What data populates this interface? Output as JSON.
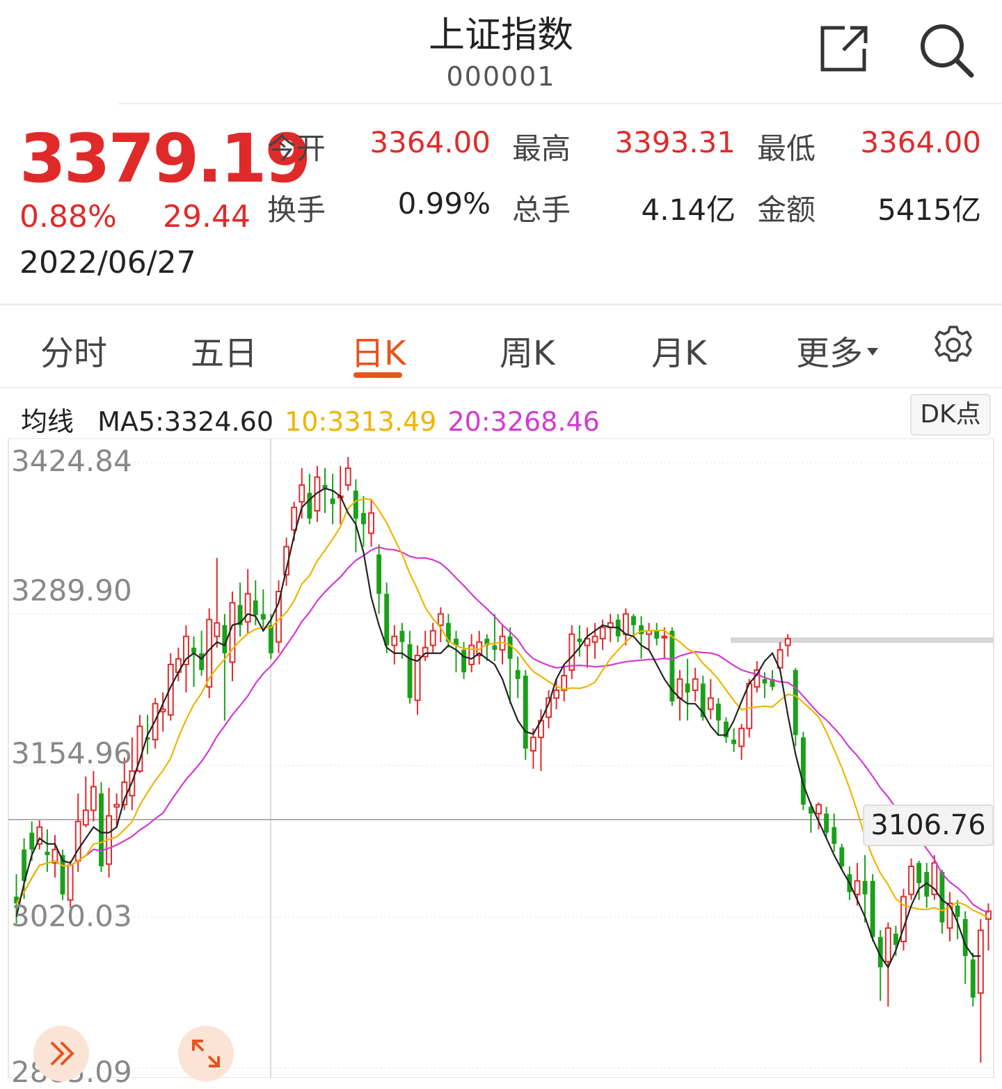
{
  "header": {
    "title": "上证指数",
    "code": "000001",
    "share_icon": "share-icon",
    "search_icon": "search-icon"
  },
  "quote": {
    "price": "3379.19",
    "change_pct": "0.88%",
    "change_value": "29.44",
    "date": "2022/06/27",
    "fields": {
      "open_label": "今开",
      "open_value": "3364.00",
      "high_label": "最高",
      "high_value": "3393.31",
      "low_label": "最低",
      "low_value": "3364.00",
      "turnover_label": "换手",
      "turnover_value": "0.99%",
      "volume_label": "总手",
      "volume_value": "4.14亿",
      "amount_label": "金额",
      "amount_value": "5415亿"
    }
  },
  "tabs": [
    {
      "label": "分时"
    },
    {
      "label": "五日"
    },
    {
      "label": "日K",
      "active": true
    },
    {
      "label": "周K"
    },
    {
      "label": "月K"
    },
    {
      "label": "更多"
    }
  ],
  "settings_icon": "gear-icon",
  "ma": {
    "label": "均线",
    "ma5": "MA5:3324.60",
    "ma10": "10:3313.49",
    "ma20": "20:3268.46",
    "dk_button": "DK点"
  },
  "colors": {
    "up": "#e02a2a",
    "down": "#1aa01a",
    "ma5": "#222222",
    "ma10": "#f0b400",
    "ma20": "#d23ad2",
    "accent": "#e8541c"
  },
  "chart_data": {
    "type": "candlestick",
    "y_axis_labels": [
      "3424.84",
      "3289.90",
      "3154.96",
      "3020.03",
      "2885.09"
    ],
    "crosshair_value": "3106.76",
    "ylim": [
      2885.09,
      3424.84
    ],
    "candles": [
      [
        3038,
        3032,
        3058,
        3014
      ],
      [
        3080,
        3052,
        3090,
        3036
      ],
      [
        3095,
        3080,
        3105,
        3070
      ],
      [
        3085,
        3100,
        3106,
        3080
      ],
      [
        3078,
        3075,
        3098,
        3060
      ],
      [
        3068,
        3080,
        3093,
        3055
      ],
      [
        3075,
        3040,
        3080,
        3035
      ],
      [
        3035,
        3066,
        3070,
        3028
      ],
      [
        3070,
        3105,
        3130,
        3060
      ],
      [
        3102,
        3115,
        3145,
        3100
      ],
      [
        3115,
        3136,
        3150,
        3105
      ],
      [
        3130,
        3065,
        3140,
        3060
      ],
      [
        3067,
        3110,
        3135,
        3055
      ],
      [
        3118,
        3120,
        3130,
        3100
      ],
      [
        3120,
        3140,
        3162,
        3115
      ],
      [
        3128,
        3150,
        3180,
        3115
      ],
      [
        3150,
        3190,
        3200,
        3148
      ],
      [
        3180,
        3178,
        3200,
        3165
      ],
      [
        3178,
        3210,
        3215,
        3170
      ],
      [
        3203,
        3205,
        3220,
        3185
      ],
      [
        3200,
        3245,
        3255,
        3195
      ],
      [
        3238,
        3250,
        3260,
        3230
      ],
      [
        3245,
        3270,
        3280,
        3220
      ],
      [
        3260,
        3255,
        3270,
        3225
      ],
      [
        3255,
        3240,
        3275,
        3235
      ],
      [
        3225,
        3285,
        3295,
        3215
      ],
      [
        3270,
        3282,
        3340,
        3260
      ],
      [
        3280,
        3255,
        3290,
        3195
      ],
      [
        3247,
        3300,
        3310,
        3230
      ],
      [
        3298,
        3280,
        3318,
        3270
      ],
      [
        3283,
        3308,
        3330,
        3272
      ],
      [
        3302,
        3289,
        3320,
        3280
      ],
      [
        3290,
        3285,
        3312,
        3275
      ],
      [
        3280,
        3255,
        3290,
        3250
      ],
      [
        3265,
        3310,
        3320,
        3255
      ],
      [
        3325,
        3350,
        3358,
        3315
      ],
      [
        3365,
        3385,
        3390,
        3355
      ],
      [
        3390,
        3405,
        3420,
        3375
      ],
      [
        3398,
        3375,
        3415,
        3370
      ],
      [
        3382,
        3412,
        3422,
        3372
      ],
      [
        3405,
        3402,
        3420,
        3380
      ],
      [
        3393,
        3388,
        3415,
        3370
      ],
      [
        3395,
        3395,
        3422,
        3370
      ],
      [
        3405,
        3420,
        3430,
        3400
      ],
      [
        3400,
        3375,
        3410,
        3345
      ],
      [
        3380,
        3370,
        3395,
        3350
      ],
      [
        3362,
        3380,
        3392,
        3350
      ],
      [
        3343,
        3308,
        3352,
        3290
      ],
      [
        3308,
        3262,
        3318,
        3255
      ],
      [
        3262,
        3270,
        3280,
        3245
      ],
      [
        3275,
        3265,
        3282,
        3250
      ],
      [
        3263,
        3215,
        3275,
        3210
      ],
      [
        3213,
        3253,
        3262,
        3200
      ],
      [
        3252,
        3260,
        3275,
        3248
      ],
      [
        3262,
        3275,
        3282,
        3255
      ],
      [
        3280,
        3290,
        3296,
        3265
      ],
      [
        3282,
        3265,
        3290,
        3260
      ],
      [
        3268,
        3262,
        3275,
        3238
      ],
      [
        3258,
        3238,
        3265,
        3232
      ],
      [
        3245,
        3262,
        3272,
        3238
      ],
      [
        3253,
        3265,
        3275,
        3245
      ],
      [
        3268,
        3262,
        3272,
        3248
      ],
      [
        3262,
        3258,
        3290,
        3248
      ],
      [
        3258,
        3270,
        3280,
        3245
      ],
      [
        3270,
        3250,
        3278,
        3210
      ],
      [
        3240,
        3232,
        3252,
        3215
      ],
      [
        3235,
        3170,
        3240,
        3160
      ],
      [
        3168,
        3180,
        3188,
        3152
      ],
      [
        3180,
        3195,
        3205,
        3150
      ],
      [
        3198,
        3215,
        3222,
        3188
      ],
      [
        3215,
        3222,
        3232,
        3205
      ],
      [
        3222,
        3235,
        3245,
        3212
      ],
      [
        3240,
        3272,
        3280,
        3232
      ],
      [
        3268,
        3265,
        3280,
        3252
      ],
      [
        3262,
        3268,
        3278,
        3242
      ],
      [
        3265,
        3270,
        3282,
        3250
      ],
      [
        3268,
        3278,
        3285,
        3258
      ],
      [
        3278,
        3282,
        3290,
        3265
      ],
      [
        3285,
        3270,
        3290,
        3265
      ],
      [
        3272,
        3290,
        3295,
        3262
      ],
      [
        3288,
        3280,
        3290,
        3270
      ],
      [
        3280,
        3272,
        3288,
        3250
      ],
      [
        3272,
        3275,
        3282,
        3258
      ],
      [
        3275,
        3268,
        3282,
        3262
      ],
      [
        3270,
        3270,
        3278,
        3250
      ],
      [
        3275,
        3212,
        3278,
        3208
      ],
      [
        3215,
        3232,
        3240,
        3195
      ],
      [
        3228,
        3220,
        3250,
        3195
      ],
      [
        3222,
        3232,
        3242,
        3212
      ],
      [
        3228,
        3198,
        3235,
        3195
      ],
      [
        3205,
        3215,
        3232,
        3196
      ],
      [
        3210,
        3195,
        3215,
        3182
      ],
      [
        3194,
        3180,
        3198,
        3175
      ],
      [
        3178,
        3174,
        3188,
        3167
      ],
      [
        3172,
        3188,
        3192,
        3160
      ],
      [
        3188,
        3228,
        3232,
        3180
      ],
      [
        3225,
        3240,
        3248,
        3220
      ],
      [
        3232,
        3228,
        3238,
        3215
      ],
      [
        3232,
        3225,
        3240,
        3222
      ],
      [
        3242,
        3258,
        3265,
        3238
      ],
      [
        3262,
        3268,
        3272,
        3252
      ],
      [
        3240,
        3182,
        3242,
        3172
      ],
      [
        3180,
        3120,
        3185,
        3115
      ],
      [
        3118,
        3112,
        3122,
        3095
      ],
      [
        3112,
        3120,
        3122,
        3098
      ],
      [
        3112,
        3095,
        3118,
        3090
      ],
      [
        3100,
        3085,
        3112,
        3078
      ],
      [
        3082,
        3065,
        3085,
        3062
      ],
      [
        3058,
        3042,
        3065,
        3035
      ],
      [
        3040,
        3052,
        3068,
        3030
      ],
      [
        3052,
        3040,
        3075,
        3015
      ],
      [
        3052,
        3002,
        3058,
        2998
      ],
      [
        3002,
        2975,
        3008,
        2945
      ],
      [
        2980,
        3010,
        3015,
        2940
      ],
      [
        3005,
        2995,
        3012,
        2985
      ],
      [
        2998,
        3038,
        3045,
        2990
      ],
      [
        3040,
        3065,
        3072,
        3035
      ],
      [
        3068,
        3050,
        3070,
        3035
      ],
      [
        3060,
        3038,
        3068,
        3028
      ],
      [
        3040,
        3068,
        3075,
        3035
      ],
      [
        3060,
        3015,
        3062,
        3005
      ],
      [
        3010,
        3032,
        3042,
        2998
      ],
      [
        3030,
        3020,
        3035,
        3000
      ],
      [
        3018,
        2985,
        3025,
        2960
      ],
      [
        2982,
        2948,
        2988,
        2940
      ],
      [
        2952,
        3008,
        3018,
        2890
      ],
      [
        3018,
        3025,
        3032,
        2990
      ]
    ],
    "ma5": [
      3020,
      3050,
      3075,
      3090,
      3085,
      3085,
      3070,
      3068,
      3080,
      3090,
      3100,
      3095,
      3095,
      3100,
      3125,
      3140,
      3160,
      3182,
      3195,
      3210,
      3225,
      3238,
      3250,
      3255,
      3250,
      3258,
      3265,
      3262,
      3280,
      3282,
      3290,
      3288,
      3275,
      3285,
      3300,
      3330,
      3360,
      3385,
      3392,
      3398,
      3402,
      3400,
      3395,
      3380,
      3370,
      3345,
      3305,
      3280,
      3260,
      3255,
      3255,
      3250,
      3248,
      3255,
      3255,
      3255,
      3262,
      3258,
      3252,
      3250,
      3255,
      3250,
      3245,
      3232,
      3212,
      3195,
      3185,
      3183,
      3195,
      3210,
      3232,
      3245,
      3252,
      3260,
      3270,
      3275,
      3280,
      3278,
      3278,
      3272,
      3270,
      3262,
      3258,
      3245,
      3232,
      3222,
      3215,
      3210,
      3210,
      3202,
      3190,
      3182,
      3182,
      3195,
      3212,
      3228,
      3236,
      3248,
      3255,
      3240,
      3200,
      3165,
      3138,
      3120,
      3105,
      3090,
      3075,
      3062,
      3050,
      3035,
      3020,
      3000,
      2985,
      2975,
      2990,
      3010,
      3030,
      3045,
      3050,
      3045,
      3035,
      3030,
      3015,
      2995,
      2985,
      2985
    ]
  }
}
